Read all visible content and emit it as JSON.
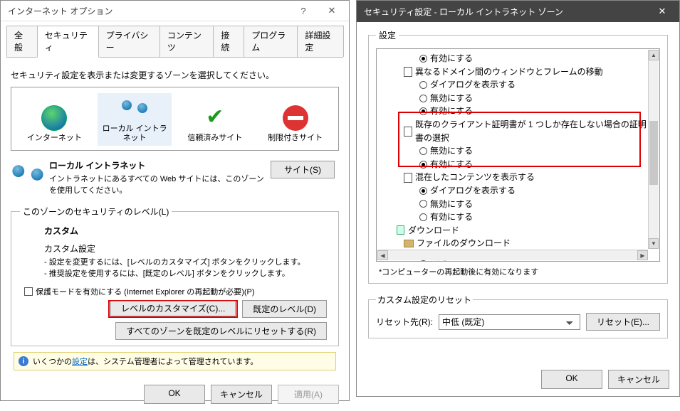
{
  "left": {
    "title": "インターネット オプション",
    "tabs": [
      "全般",
      "セキュリティ",
      "プライバシー",
      "コンテンツ",
      "接続",
      "プログラム",
      "詳細設定"
    ],
    "zone_prompt": "セキュリティ設定を表示または変更するゾーンを選択してください。",
    "zones": {
      "internet": "インターネット",
      "intranet": "ローカル イントラネット",
      "trusted": "信頼済みサイト",
      "restricted": "制限付きサイト"
    },
    "detail": {
      "title": "ローカル イントラネット",
      "desc": "イントラネットにあるすべての Web サイトには、このゾーンを使用してください。",
      "sites_btn": "サイト(S)"
    },
    "level": {
      "legend": "このゾーンのセキュリティのレベル(L)",
      "custom_title": "カスタム",
      "custom_sub": "カスタム設定",
      "line1": "- 設定を変更するには、[レベルのカスタマイズ] ボタンをクリックします。",
      "line2": "- 推奨設定を使用するには、[既定のレベル] ボタンをクリックします。",
      "protected": "保護モードを有効にする (Internet Explorer の再起動が必要)(P)",
      "customize_btn": "レベルのカスタマイズ(C)...",
      "default_btn": "既定のレベル(D)",
      "reset_all_btn": "すべてのゾーンを既定のレベルにリセットする(R)"
    },
    "info": {
      "prefix": "いくつかの",
      "link": "設定",
      "suffix": "は、システム管理者によって管理されています。"
    },
    "buttons": {
      "ok": "OK",
      "cancel": "キャンセル",
      "apply": "適用(A)"
    }
  },
  "right": {
    "title": "セキュリティ設定 - ローカル イントラネット ゾーン",
    "legend": "設定",
    "tree": {
      "opt_enable": "有効にする",
      "opt_disable": "無効にする",
      "opt_dialog": "ダイアログを表示する",
      "grp_frames": "異なるドメイン間のウィンドウとフレームの移動",
      "grp_cert": "既存のクライアント証明書が 1 つしか存在しない場合の証明書の選択",
      "grp_mixed": "混在したコンテンツを表示する",
      "grp_download": "ダウンロード",
      "grp_filedl": "ファイルのダウンロード"
    },
    "footnote": "*コンピューターの再起動後に有効になります",
    "reset": {
      "legend": "カスタム設定のリセット",
      "label": "リセット先(R):",
      "value": "中低 (既定)",
      "btn": "リセット(E)..."
    },
    "buttons": {
      "ok": "OK",
      "cancel": "キャンセル"
    }
  }
}
